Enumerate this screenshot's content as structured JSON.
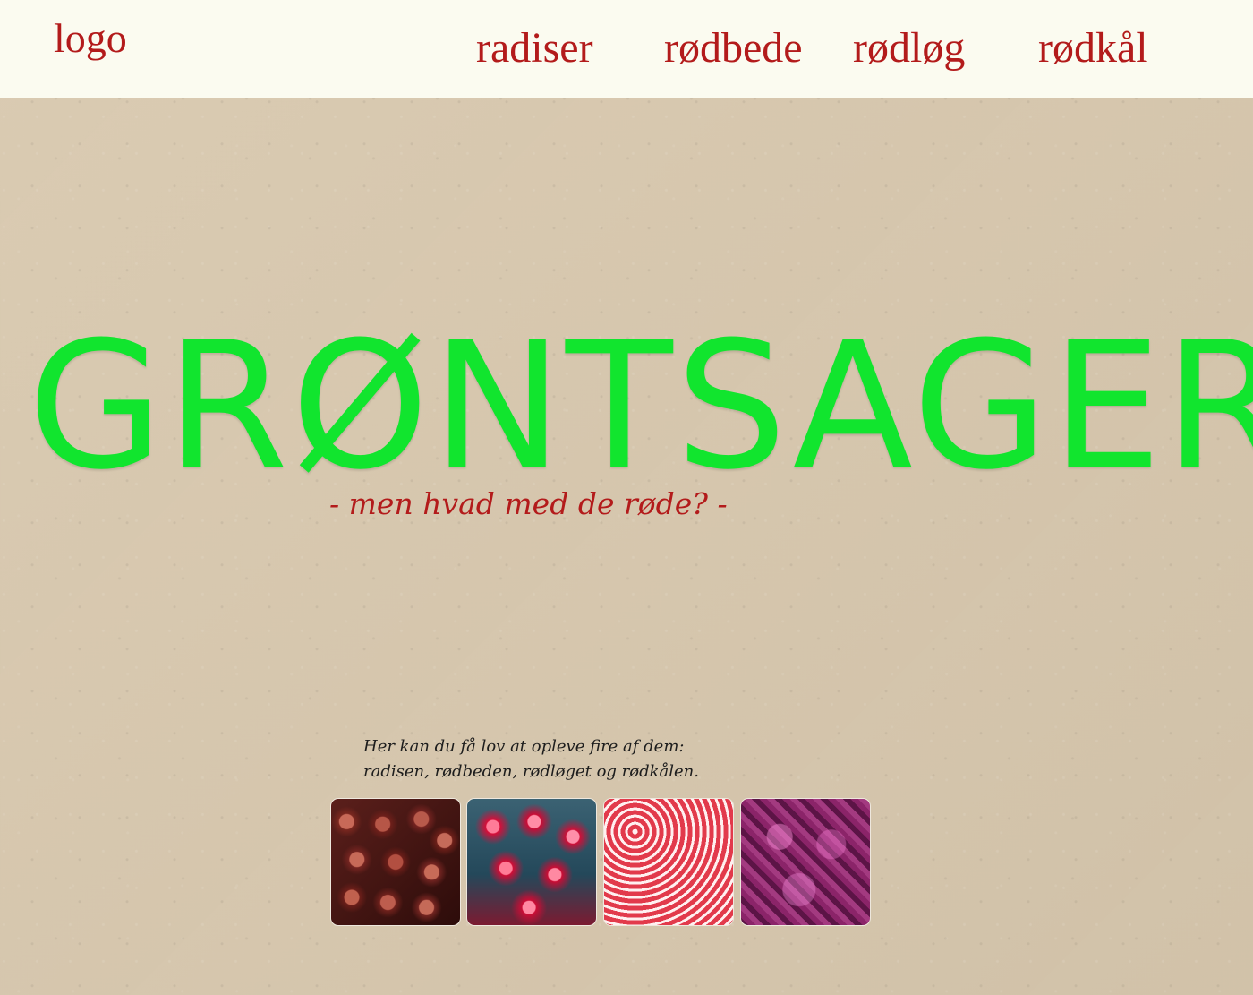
{
  "header": {
    "logo": "logo",
    "nav": [
      "radiser",
      "rødbede",
      "rødløg",
      "rødkål"
    ]
  },
  "hero": {
    "title": "GRØNTSAGER",
    "subtitle": "- men hvad med de røde? -"
  },
  "intro": {
    "text": "Her kan du få lov at opleve fire af dem:\nradisen, rødbeden, rødløget og rødkålen."
  },
  "gallery": {
    "images": [
      "red-onion-image",
      "radish-image",
      "beet-slices-image",
      "red-kale-image"
    ]
  }
}
